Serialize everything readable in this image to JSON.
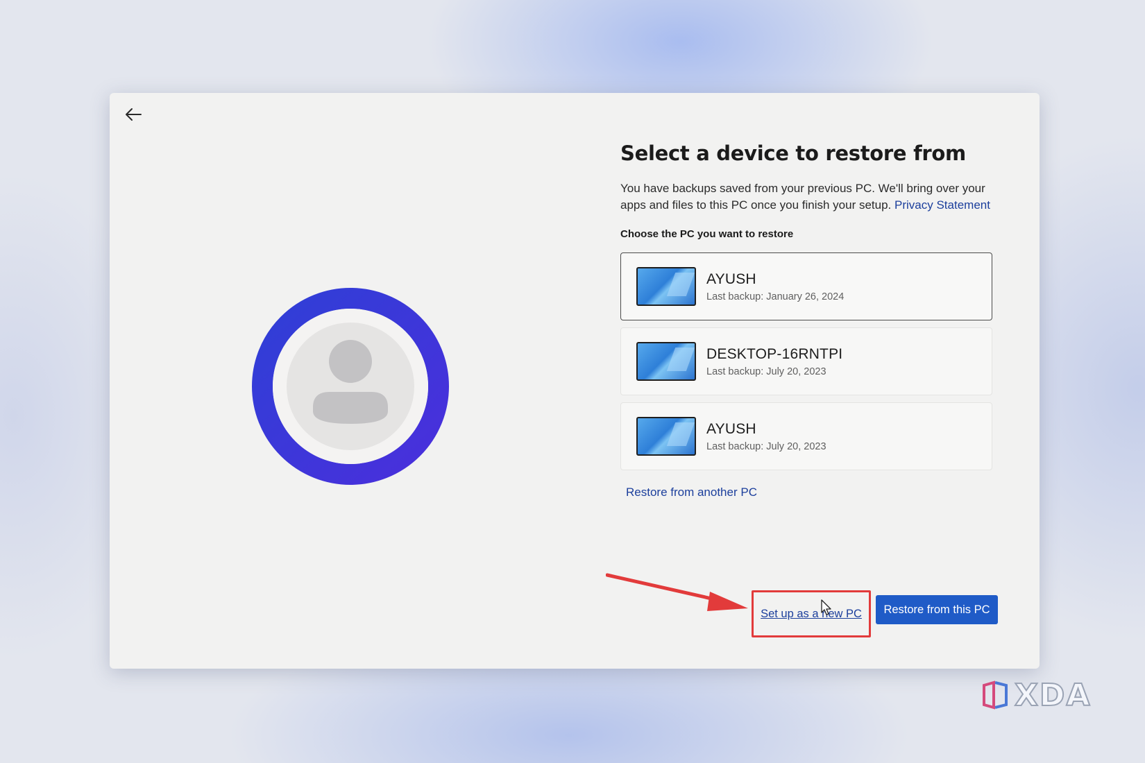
{
  "page": {
    "title": "Select a device to restore from",
    "description": "You have backups saved from your previous PC. We'll bring over your apps and files to this PC once you finish your setup.",
    "privacy_link": "Privacy Statement",
    "choose_label": "Choose the PC you want to restore"
  },
  "devices": [
    {
      "name": "AYUSH",
      "last_backup": "Last backup: January 26, 2024",
      "selected": true
    },
    {
      "name": "DESKTOP-16RNTPI",
      "last_backup": "Last backup: July 20, 2023",
      "selected": false
    },
    {
      "name": "AYUSH",
      "last_backup": "Last backup: July 20, 2023",
      "selected": false
    }
  ],
  "actions": {
    "restore_another": "Restore from another PC",
    "setup_new": "Set up as a new PC",
    "restore_this": "Restore from this PC"
  },
  "watermark": {
    "text": "XDA"
  },
  "icons": {
    "back": "back-arrow-icon",
    "avatar": "user-avatar-icon",
    "device": "pc-thumbnail-icon",
    "annotation": "red-arrow-annotation",
    "cursor": "mouse-cursor-icon"
  },
  "colors": {
    "accent": "#1f5bc7",
    "link": "#1c3f9c",
    "highlight": "#e23b3b",
    "avatar_ring": "#3838d8"
  }
}
